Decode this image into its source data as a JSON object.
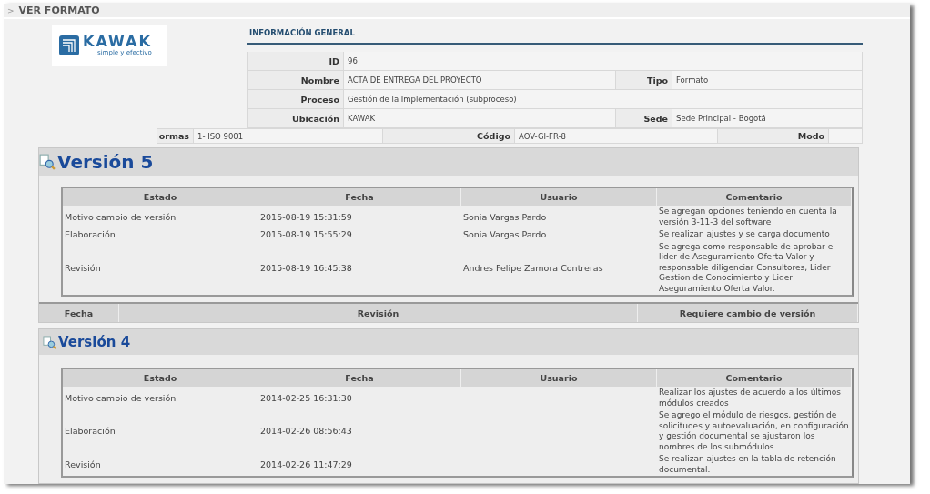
{
  "header": {
    "marker": ">",
    "title": "VER FORMATO"
  },
  "logo": {
    "name": "KAWAK",
    "tagline": "simple y efectivo"
  },
  "info": {
    "title": "INFORMACIÓN GENERAL",
    "rows": [
      [
        {
          "label": "ID",
          "value": "96"
        }
      ],
      [
        {
          "label": "Nombre",
          "value": "ACTA DE ENTREGA DEL PROYECTO"
        },
        {
          "label": "Tipo",
          "value": "Formato"
        }
      ],
      [
        {
          "label": "Proceso",
          "value": "Gestión de la Implementación (subproceso)"
        }
      ],
      [
        {
          "label": "Ubicación",
          "value": "KAWAK"
        },
        {
          "label": "Sede",
          "value": "Sede Principal - Bogotá"
        }
      ]
    ],
    "normas_row": [
      {
        "label": "ormas",
        "value": "1- ISO 9001"
      },
      {
        "label": "Código",
        "value": "AOV-GI-FR-8"
      },
      {
        "label": "Modo"
      }
    ]
  },
  "versions": [
    {
      "title": "Versión 5",
      "magnified": true,
      "columns": [
        "Estado",
        "Fecha",
        "Usuario",
        "Comentario"
      ],
      "rows": [
        {
          "estado": "Motivo cambio de versión",
          "fecha": "2015-08-19 15:31:59",
          "usuario": "Sonia Vargas Pardo",
          "comentario": "Se agregan opciones teniendo en cuenta la versión 3-11-3 del software"
        },
        {
          "estado": "Elaboración",
          "fecha": "2015-08-19 15:55:29",
          "usuario": "Sonia Vargas Pardo",
          "comentario": "Se realizan ajustes y se carga documento"
        },
        {
          "estado": "Revisión",
          "fecha": "2015-08-19 16:45:38",
          "usuario": "Andres Felipe Zamora Contreras",
          "comentario": "Se agrega como responsable de aprobar el lider de Aseguramiento Oferta Valor y responsable diligenciar Consultores, Lider Gestion de Conocimiento y Lider Aseguramiento Oferta Valor."
        }
      ],
      "footer_columns": [
        "Fecha",
        "Revisión",
        "Requiere cambio de versión"
      ]
    },
    {
      "title": "Versión 4",
      "magnified": false,
      "columns": [
        "Estado",
        "Fecha",
        "Usuario",
        "Comentario"
      ],
      "rows": [
        {
          "estado": "Motivo cambio de versión",
          "fecha": "2014-02-25 16:31:30",
          "comentario": "Realizar los ajustes de acuerdo a los últimos módulos creados"
        },
        {
          "estado": "Elaboración",
          "fecha": "2014-02-26 08:56:43",
          "comentario": "Se agrego el módulo de riesgos, gestión de solicitudes y autoevaluación, en configuración y gestión documental se ajustaron los nombres de los submódulos"
        },
        {
          "estado": "Revisión",
          "fecha": "2014-02-26 11:47:29",
          "comentario": "Se realizan ajustes en la tabla de retención documental."
        }
      ]
    }
  ]
}
